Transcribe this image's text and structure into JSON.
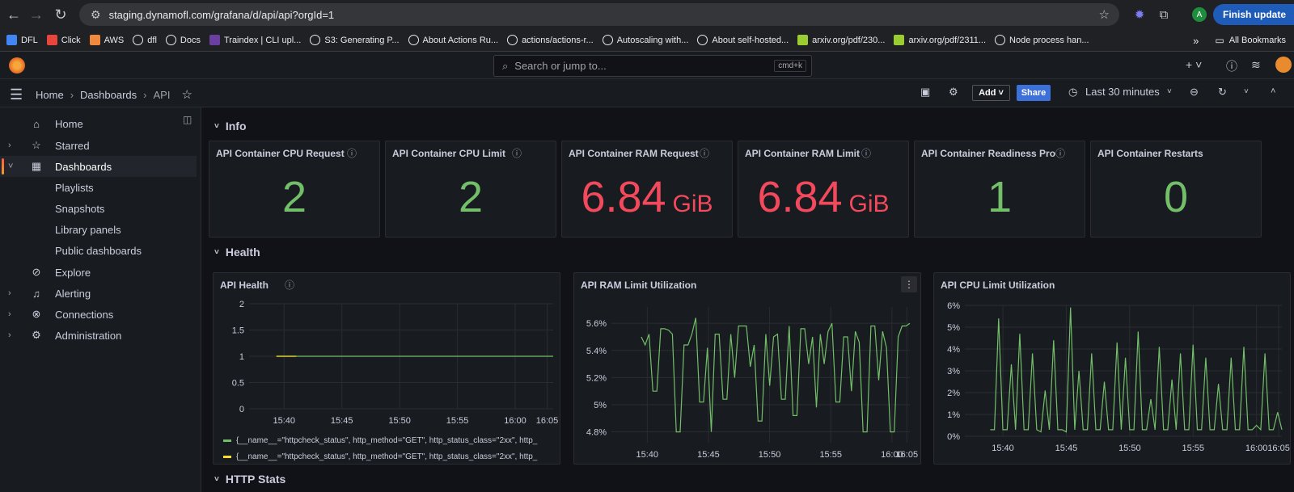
{
  "browser": {
    "url": "staging.dynamofl.com/grafana/d/api/api?orgId=1",
    "finish_update": "Finish update",
    "profile_initial": "A",
    "bookmarks": [
      {
        "label": "DFL",
        "color": "#4285f4",
        "icon": "dfl-icon"
      },
      {
        "label": "Click",
        "color": "#e8453c",
        "icon": "clickup-icon"
      },
      {
        "label": "AWS",
        "color": "#f0883e",
        "icon": "aws-icon"
      },
      {
        "label": "dfl",
        "color": "#ffffff",
        "icon": "github-icon"
      },
      {
        "label": "Docs",
        "color": "#ffffff",
        "icon": "notion-icon"
      },
      {
        "label": "Traindex | CLI upl...",
        "color": "#6b3fa0",
        "icon": "traindex-icon"
      },
      {
        "label": "S3: Generating P...",
        "color": "#ffffff",
        "icon": "github-icon"
      },
      {
        "label": "About Actions Ru...",
        "color": "#ffffff",
        "icon": "github-icon"
      },
      {
        "label": "actions/actions-r...",
        "color": "#ffffff",
        "icon": "github-icon"
      },
      {
        "label": "Autoscaling with...",
        "color": "#ffffff",
        "icon": "github-icon"
      },
      {
        "label": "About self-hosted...",
        "color": "#ffffff",
        "icon": "github-icon"
      },
      {
        "label": "arxiv.org/pdf/230...",
        "color": "#9acd32",
        "icon": "arxiv-icon"
      },
      {
        "label": "arxiv.org/pdf/2311...",
        "color": "#9acd32",
        "icon": "arxiv-icon"
      },
      {
        "label": "Node process han...",
        "color": "#ffffff",
        "icon": "github-icon"
      }
    ],
    "overflow": "»",
    "all_bookmarks": "All Bookmarks"
  },
  "grafana": {
    "search_placeholder": "Search or jump to...",
    "search_shortcut": "cmd+k",
    "breadcrumbs": [
      "Home",
      "Dashboards",
      "API"
    ],
    "add_label": "Add",
    "share_label": "Share",
    "time_range": "Last 30 minutes"
  },
  "sidebar": {
    "items": [
      {
        "label": "Home",
        "icon": "home-icon"
      },
      {
        "label": "Starred",
        "icon": "star-icon"
      },
      {
        "label": "Dashboards",
        "icon": "dashboards-icon"
      },
      {
        "label": "Playlists"
      },
      {
        "label": "Snapshots"
      },
      {
        "label": "Library panels"
      },
      {
        "label": "Public dashboards"
      },
      {
        "label": "Explore",
        "icon": "compass-icon"
      },
      {
        "label": "Alerting",
        "icon": "bell-icon"
      },
      {
        "label": "Connections",
        "icon": "connections-icon"
      },
      {
        "label": "Administration",
        "icon": "gear-icon"
      }
    ]
  },
  "rows": {
    "info": "Info",
    "health": "Health",
    "http": "HTTP Stats"
  },
  "stats": [
    {
      "title": "API Container CPU Request",
      "value": "2",
      "unit": "",
      "color": "#73bf69"
    },
    {
      "title": "API Container CPU Limit",
      "value": "2",
      "unit": "",
      "color": "#73bf69"
    },
    {
      "title": "API Container RAM Request",
      "value": "6.84",
      "unit": "GiB",
      "color": "#f2495c"
    },
    {
      "title": "API Container RAM Limit",
      "value": "6.84",
      "unit": "GiB",
      "color": "#f2495c"
    },
    {
      "title": "API Container Readiness Pro",
      "value": "1",
      "unit": "",
      "color": "#73bf69"
    },
    {
      "title": "API Container Restarts",
      "value": "0",
      "unit": "",
      "color": "#73bf69"
    }
  ],
  "chart_data": [
    {
      "type": "line",
      "title": "API Health",
      "x": [
        "15:40",
        "15:45",
        "15:50",
        "15:55",
        "16:00",
        "16:05"
      ],
      "yticks": [
        "0",
        "0.5",
        "1",
        "1.5",
        "2"
      ],
      "ylim": [
        0,
        2
      ],
      "series": [
        {
          "name": "{__name__=\"httpcheck_status\", http_method=\"GET\", http_status_class=\"2xx\", http_",
          "color": "#73bf69",
          "values": [
            1,
            1,
            1,
            1,
            1,
            1,
            1,
            1
          ]
        },
        {
          "name": "{__name__=\"httpcheck_status\", http_method=\"GET\", http_status_class=\"2xx\", http_",
          "color": "#fade2a",
          "values": [
            1,
            1
          ]
        }
      ]
    },
    {
      "type": "line",
      "title": "API RAM Limit Utilization",
      "x": [
        "15:40",
        "15:45",
        "15:50",
        "15:55",
        "16:00",
        "16:05"
      ],
      "yticks": [
        "4.8%",
        "5%",
        "5.2%",
        "5.4%",
        "5.6%"
      ],
      "ylim": [
        4.72,
        5.72
      ],
      "series": [
        {
          "color": "#73bf69",
          "values": [
            5.5,
            5.44,
            5.52,
            5.1,
            5.1,
            5.56,
            5.56,
            5.55,
            5.52,
            4.8,
            4.8,
            5.44,
            5.44,
            5.52,
            5.64,
            5.02,
            5.02,
            5.42,
            4.8,
            5.52,
            5.52,
            5.04,
            5.04,
            5.52,
            5.2,
            5.58,
            5.58,
            5.58,
            5.28,
            5.44,
            4.88,
            4.88,
            5.52,
            5.14,
            5.5,
            5.52,
            5.04,
            5.04,
            5.58,
            4.92,
            4.92,
            5.56,
            5.56,
            5.3,
            5.5,
            4.98,
            5.52,
            5.3,
            5.54,
            5.6,
            5.02,
            5.02,
            5.5,
            5.5,
            5.1,
            5.54,
            5.46,
            4.8,
            4.8,
            5.58,
            5.58,
            5.18,
            5.54,
            5.42,
            4.8,
            4.8,
            5.5,
            5.58,
            5.58,
            5.6
          ]
        }
      ]
    },
    {
      "type": "line",
      "title": "API CPU Limit Utilization",
      "x": [
        "15:40",
        "15:45",
        "15:50",
        "15:55",
        "16:00",
        "16:05"
      ],
      "yticks": [
        "0%",
        "1%",
        "2%",
        "3%",
        "4%",
        "5%",
        "6%"
      ],
      "ylim": [
        0,
        6
      ],
      "series": [
        {
          "color": "#73bf69",
          "values": [
            0.3,
            0.3,
            5.4,
            0.3,
            0.3,
            3.3,
            0.3,
            4.7,
            0.3,
            0.3,
            3.8,
            0.3,
            0.2,
            2.1,
            0.3,
            4.4,
            0.3,
            0.3,
            0.2,
            5.9,
            0.3,
            3.0,
            0.3,
            0.3,
            3.8,
            0.3,
            0.3,
            2.5,
            0.3,
            0.3,
            4.3,
            0.3,
            3.6,
            0.3,
            0.3,
            4.8,
            0.3,
            0.3,
            1.7,
            0.3,
            4.1,
            0.3,
            0.3,
            2.6,
            0.3,
            3.8,
            0.3,
            0.3,
            4.2,
            0.3,
            0.3,
            3.6,
            0.3,
            0.3,
            2.4,
            0.3,
            0.3,
            3.6,
            0.3,
            0.3,
            4.1,
            0.3,
            0.3,
            0.5,
            0.3,
            3.8,
            0.3,
            0.3,
            1.1,
            0.3
          ]
        }
      ]
    }
  ]
}
